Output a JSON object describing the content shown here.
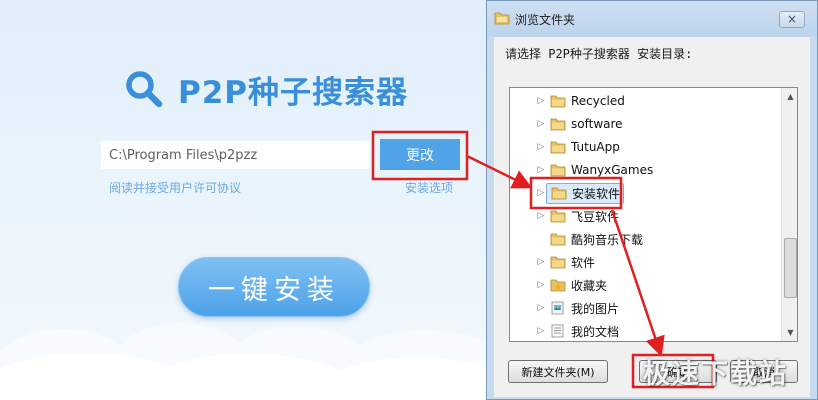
{
  "installer": {
    "logo_text": "P2P种子搜索器",
    "install_path": "C:\\Program Files\\p2pzz",
    "change_button": "更改",
    "license_link": "阅读并接受用户许可协议",
    "options_link": "安装选项",
    "install_button": "一键安装",
    "accent_color": "#3a8fda"
  },
  "dialog": {
    "title": "浏览文件夹",
    "close_icon": "×",
    "prompt": "请选择 P2P种子搜索器 安装目录:",
    "tree_items": [
      {
        "label": "Recycled",
        "expandable": true,
        "icon": "folder-icon"
      },
      {
        "label": "software",
        "expandable": true,
        "icon": "folder-icon"
      },
      {
        "label": "TutuApp",
        "expandable": true,
        "icon": "folder-icon"
      },
      {
        "label": "WanyxGames",
        "expandable": true,
        "icon": "folder-icon"
      },
      {
        "label": "安装软件",
        "expandable": true,
        "icon": "folder-icon",
        "selected": true
      },
      {
        "label": "飞豆软件",
        "expandable": true,
        "icon": "folder-icon"
      },
      {
        "label": "酷狗音乐下载",
        "expandable": false,
        "icon": "folder-icon"
      },
      {
        "label": "软件",
        "expandable": true,
        "icon": "folder-icon"
      },
      {
        "label": "收藏夹",
        "expandable": true,
        "icon": "favorites-folder-icon"
      },
      {
        "label": "我的图片",
        "expandable": true,
        "icon": "pictures-library-icon"
      },
      {
        "label": "我的文档",
        "expandable": true,
        "icon": "documents-library-icon"
      }
    ],
    "new_folder_button": "新建文件夹(M)",
    "ok_button": "确定",
    "cancel_button": "取消"
  },
  "annotation": {
    "highlight_color": "#e02020",
    "watermark": "极速下载站"
  }
}
